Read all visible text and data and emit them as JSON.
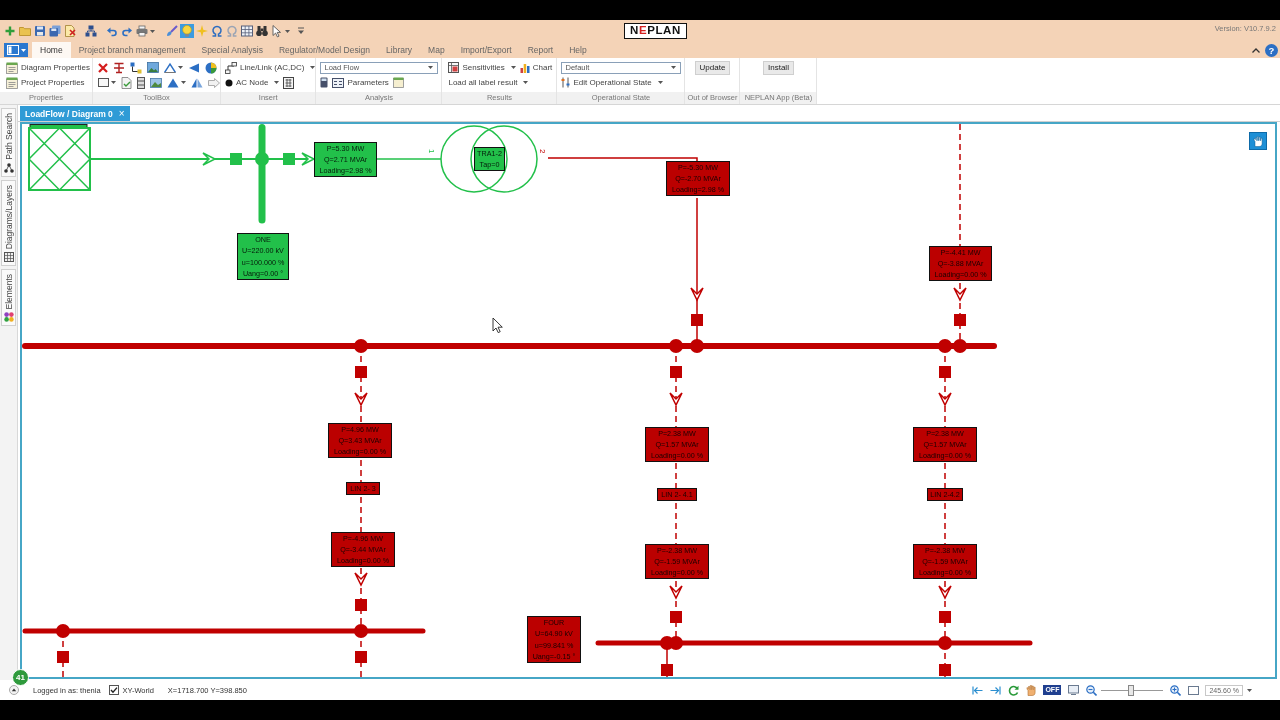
{
  "title_bar": {
    "logo": [
      {
        "text": "N",
        "color": "#111111"
      },
      {
        "text": "E",
        "color": "#d42020"
      },
      {
        "text": "PLAN",
        "color": "#111111"
      }
    ],
    "version": "Version: V10.7.9.2"
  },
  "quick_access": [
    {
      "pressed": false
    },
    {
      "pressed": false
    },
    {
      "pressed": false
    },
    {
      "pressed": false
    },
    {
      "pressed": false
    },
    {
      "pressed": false
    },
    {
      "pressed": false
    },
    {
      "pressed": false
    },
    {
      "pressed": false
    },
    {
      "pressed": false
    },
    {
      "pressed": true
    },
    {
      "pressed": false
    },
    {
      "pressed": false
    },
    {
      "pressed": false
    },
    {
      "pressed": false
    },
    {
      "pressed": false
    },
    {
      "pressed": false
    },
    {
      "pressed": false
    }
  ],
  "menu": {
    "tabs": [
      {
        "label": "Home",
        "selected": true
      },
      {
        "label": "Project branch management",
        "selected": false
      },
      {
        "label": "Special Analysis",
        "selected": false
      },
      {
        "label": "Regulator/Model Design",
        "selected": false
      },
      {
        "label": "Library",
        "selected": false
      },
      {
        "label": "Map",
        "selected": false
      },
      {
        "label": "Import/Export",
        "selected": false
      },
      {
        "label": "Report",
        "selected": false
      },
      {
        "label": "Help",
        "selected": false
      }
    ],
    "help": "?"
  },
  "ribbon": [
    {
      "title": "Properties",
      "items": [
        {
          "kind": "command",
          "label": "Diagram Properties"
        },
        {
          "kind": "command",
          "label": "Project Properties"
        }
      ]
    },
    {
      "title": "ToolBox"
    },
    {
      "title": "Insert",
      "items": [
        {
          "kind": "menu",
          "label": "Line/Link (AC,DC)"
        },
        {
          "kind": "menu",
          "label": "AC Node"
        }
      ]
    },
    {
      "title": "Analysis",
      "items": [
        {
          "kind": "combo",
          "value": "Load Flow"
        },
        {
          "kind": "command",
          "label": "Parameters"
        }
      ]
    },
    {
      "title": "Results",
      "items": [
        {
          "kind": "menu",
          "label": "Sensitivities"
        },
        {
          "kind": "command",
          "label": "Chart"
        },
        {
          "kind": "menu",
          "label": "Load all label result"
        }
      ]
    },
    {
      "title": "Operational State",
      "items": [
        {
          "kind": "combo",
          "value": "Default"
        },
        {
          "kind": "menu",
          "label": "Edit Operational State"
        }
      ]
    },
    {
      "title": "Out of Browser",
      "items": [
        {
          "kind": "push",
          "label": "Update"
        }
      ]
    },
    {
      "title": "NEPLAN App (Beta)",
      "items": [
        {
          "kind": "push",
          "label": "Install"
        }
      ]
    }
  ],
  "side_tabs": [
    {
      "label": "Path Search"
    },
    {
      "label": "Diagrams/Layers"
    },
    {
      "label": "Elements"
    }
  ],
  "document_tab": {
    "title": "LoadFlow / Diagram 0",
    "close": "×"
  },
  "diagram": {
    "port_labels": [
      "1",
      "2"
    ],
    "labels": [
      {
        "kind": "flow",
        "color": "#22c04a",
        "lines": [
          "P=5.30 MW",
          "Q=2.71 MVAr",
          "Loading=2.98 %"
        ]
      },
      {
        "kind": "element",
        "color": "#22c04a",
        "lines": [
          "TRA1-2",
          "Tap=0"
        ]
      },
      {
        "kind": "flow",
        "color": "#bb0000",
        "lines": [
          "P=-5.30 MW",
          "Q=-2.70 MVAr",
          "Loading=2.98 %"
        ]
      },
      {
        "kind": "node",
        "color": "#22c04a",
        "lines": [
          "ONE",
          "U=220.00 kV",
          "u=100.000 %",
          "Uang=0.00 °"
        ]
      },
      {
        "kind": "flow",
        "color": "#bb0000",
        "lines": [
          "P=-4.41 MW",
          "Q=-3.88 MVAr",
          "Loading=0.00 %"
        ]
      },
      {
        "kind": "flow",
        "color": "#bb0000",
        "lines": [
          "P=4.96 MW",
          "Q=3.43 MVAr",
          "Loading=0.00 %"
        ]
      },
      {
        "kind": "flow",
        "color": "#bb0000",
        "lines": [
          "P=2.38 MW",
          "Q=1.57 MVAr",
          "Loading=0.00 %"
        ]
      },
      {
        "kind": "flow",
        "color": "#bb0000",
        "lines": [
          "P=2.38 MW",
          "Q=1.57 MVAr",
          "Loading=0.00 %"
        ]
      },
      {
        "kind": "element",
        "color": "#bb0000",
        "lines": [
          "LIN 2- 3"
        ]
      },
      {
        "kind": "element",
        "color": "#bb0000",
        "lines": [
          "LIN 2- 4.1"
        ]
      },
      {
        "kind": "element",
        "color": "#bb0000",
        "lines": [
          "LIN 2-4.2"
        ]
      },
      {
        "kind": "flow",
        "color": "#bb0000",
        "lines": [
          "P=-4.96 MW",
          "Q=-3.44 MVAr",
          "Loading=0.00 %"
        ]
      },
      {
        "kind": "flow",
        "color": "#bb0000",
        "lines": [
          "P=-2.38 MW",
          "Q=-1.59 MVAr",
          "Loading=0.00 %"
        ]
      },
      {
        "kind": "flow",
        "color": "#bb0000",
        "lines": [
          "P=-2.38 MW",
          "Q=-1.59 MVAr",
          "Loading=0.00 %"
        ]
      },
      {
        "kind": "node",
        "color": "#bb0000",
        "lines": [
          "FOUR",
          "U=64.90 kV",
          "u=99.841 %",
          "Uang=-0.15 °"
        ]
      }
    ]
  },
  "badge": "41",
  "status_bar": {
    "user": "Logged in as: thenia",
    "xy_world": {
      "label": "XY-World",
      "checked": true
    },
    "coordinates": "X=1718.700 Y=398.850",
    "toggle": "OFF",
    "zoom": {
      "level": 0.48,
      "value": "245.60 %"
    }
  }
}
